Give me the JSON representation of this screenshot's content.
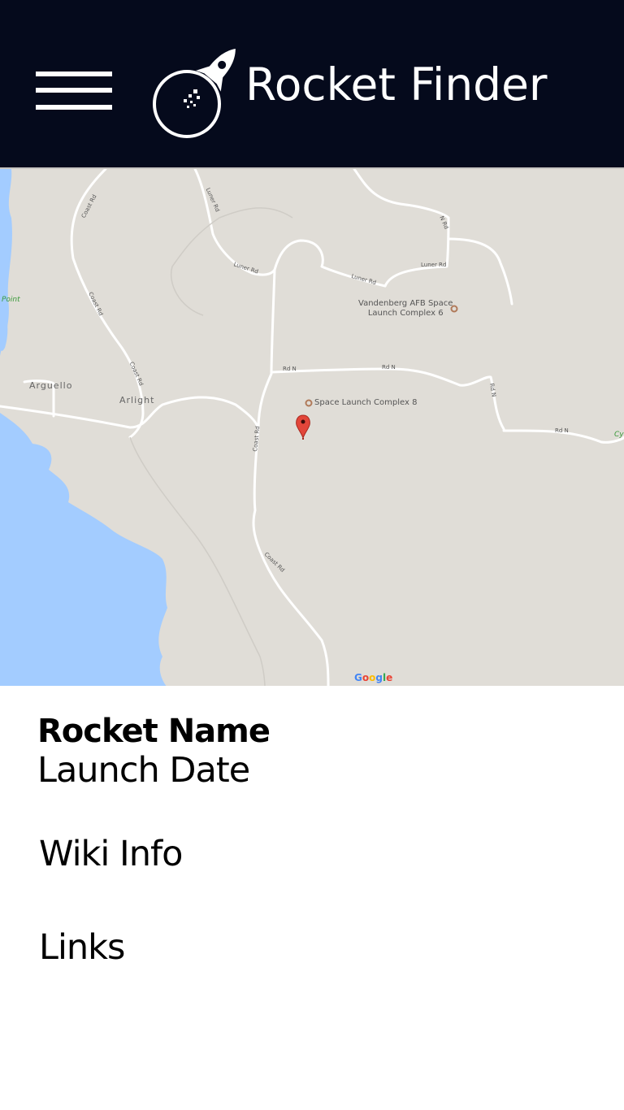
{
  "app": {
    "title": "Rocket Finder"
  },
  "header": {
    "menu_icon": "hamburger-menu-icon",
    "logo_icon": "rocket-logo-icon",
    "background_color": "#050a1c"
  },
  "map": {
    "provider_logo": "Google",
    "marker_icon": "map-pin-icon",
    "marker_color": "#e2463a",
    "water_color": "#a3ccff",
    "land_color": "#e0ddd7",
    "places": {
      "vandenberg": "Vandenberg AFB Space Launch Complex 6",
      "vandenberg_line1": "Vandenberg AFB Space",
      "vandenberg_line2": "Launch Complex 6",
      "slc8": "Space Launch Complex 8",
      "arguello": "Arguello",
      "arlight": "Arlight",
      "point": "Point",
      "cy": "Cy"
    },
    "roads": {
      "luner_rd_1": "Luner Rd",
      "luner_rd_2": "Luner Rd",
      "luner_rd_3": "Luner Rd",
      "luner_rd_4": "Luner Rd",
      "coast_rd_1": "Coast Rd",
      "coast_rd_2": "Coast Rd",
      "coast_rd_3": "Coast Rd",
      "coast_rd_4": "Coast Rd",
      "coast_rd_5": "Coast Rd",
      "rd_n_1": "Rd N",
      "rd_n_2": "Rd N",
      "rd_n_3": "Rd N",
      "rd_n_4": "Rd N",
      "n_rd": "N Rd"
    }
  },
  "details": {
    "rocket_name": "Rocket Name",
    "launch_date": "Launch Date",
    "wiki_info": "Wiki Info",
    "links": "Links"
  }
}
